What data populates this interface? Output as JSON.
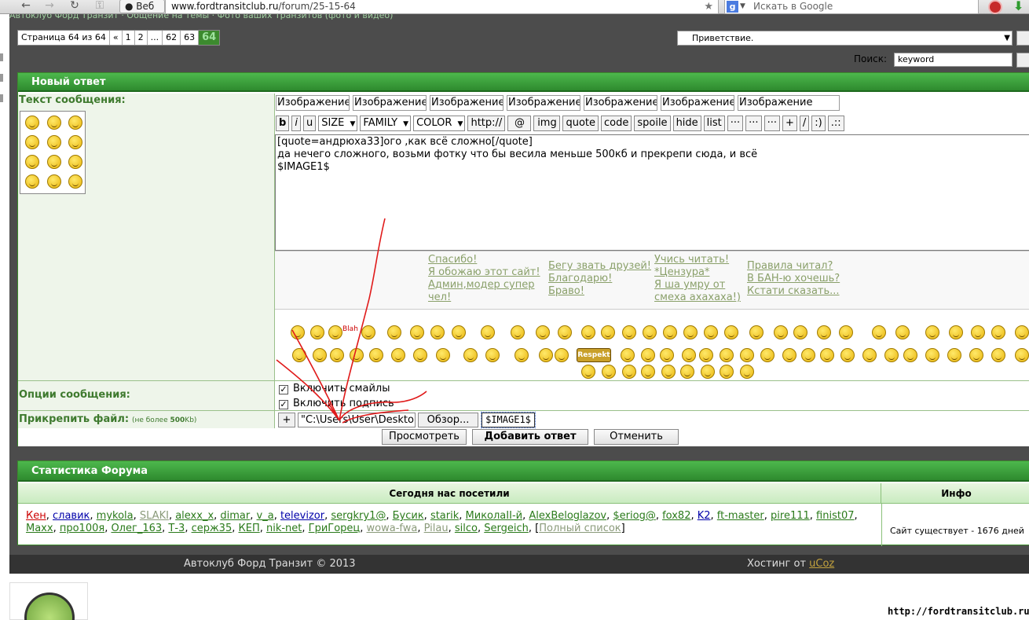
{
  "browser": {
    "web_label": "Веб",
    "url_domain": "www.fordtransitclub.ru",
    "url_path": "/forum/25-15-64",
    "search_placeholder": "Искать в Google"
  },
  "topbar": {
    "breadcrumb": "Автоклуб Форд Транзит · Общение на темы · Фото ваших Транзитов (фото и видео)",
    "pager": [
      "Страница 64 из 64",
      "«",
      "1",
      "2",
      "...",
      "62",
      "63",
      "64"
    ],
    "greeting": "Приветствие.",
    "search_label": "Поиск:",
    "search_value": "keyword"
  },
  "reply": {
    "title": "Новый ответ",
    "message_label": "Текст сообщения:",
    "image_buttons": [
      "Изображение",
      "Изображение",
      "Изображение",
      "Изображение",
      "Изображение",
      "Изображение",
      "Изображение"
    ],
    "bb_buttons": [
      "b",
      "i",
      "u",
      "SIZE",
      "FAMILY",
      "COLOR",
      "http://",
      "@",
      "img",
      "quote",
      "code",
      "spoile",
      "hide",
      "list",
      "···",
      "···",
      "···",
      "+",
      "/",
      ":)",
      ".::"
    ],
    "text_lines": [
      "[quote=андрюха33]ого ,как всё сложно[/quote]",
      "да нечего сложного, возьми фотку что бы весила меньше 500кб и прекрепи сюда, и всё",
      "$IMAGE1$"
    ],
    "quick_col1": [
      "Спасибо!",
      "Я обожаю этот сайт!",
      "Админ,модер супер",
      "чел!"
    ],
    "quick_col2": [
      "Бегу звать друзей!",
      "Благодарю!",
      "Браво!"
    ],
    "quick_col3": [
      "Учись читать!",
      "*Цензура*",
      "Я ша умру от",
      "смеха ахахаха!)"
    ],
    "quick_col4": [
      "Правила читал?",
      "В БАН-ю хочешь?",
      "Кстати сказать..."
    ],
    "options_label": "Опции сообщения:",
    "opt_smiles": "Включить смайлы",
    "opt_signature": "Включить подпись",
    "attach_label": "Прикрепить файл:",
    "attach_note_pre": "(не более ",
    "attach_note_b": "500",
    "attach_note_post": "Kb)",
    "plus": "+",
    "file_value": "\"C:\\Users\\User\\Deskto",
    "browse": "Обзор...",
    "image_tag": "$IMAGE1$",
    "btn_preview": "Просмотреть",
    "btn_submit": "Добавить ответ",
    "btn_cancel": "Отменить",
    "emoticon_blah": "Blah",
    "emoticon_respekt": "Respekt"
  },
  "stats": {
    "title": "Статистика Форума",
    "col_visitors": "Сегодня нас посетили",
    "col_info": "Инфо",
    "visitors": [
      {
        "name": "Кен",
        "color": "#cc0000"
      },
      {
        "name": "славик",
        "color": "#0000aa"
      },
      {
        "name": "mykola",
        "color": "#2a7a1a"
      },
      {
        "name": "SLAKI",
        "color": "#8a9a7a"
      },
      {
        "name": "alexx_x",
        "color": "#2a7a1a"
      },
      {
        "name": "dimar",
        "color": "#2a7a1a"
      },
      {
        "name": "v_a",
        "color": "#2a7a1a"
      },
      {
        "name": "televizor",
        "color": "#0000aa"
      },
      {
        "name": "sergkry1@",
        "color": "#2a7a1a"
      },
      {
        "name": "Бусик",
        "color": "#2a7a1a"
      },
      {
        "name": "starik",
        "color": "#2a7a1a"
      },
      {
        "name": "МиколаII-й",
        "color": "#2a7a1a"
      },
      {
        "name": "AlexBeloglazov",
        "color": "#2a7a1a"
      },
      {
        "name": "$eriog@",
        "color": "#2a7a1a"
      },
      {
        "name": "fox82",
        "color": "#2a7a1a"
      },
      {
        "name": "K2",
        "color": "#0000aa"
      },
      {
        "name": "ft-master",
        "color": "#2a7a1a"
      },
      {
        "name": "pire111",
        "color": "#2a7a1a"
      },
      {
        "name": "finist07",
        "color": "#2a7a1a"
      },
      {
        "name": "Maxx",
        "color": "#2a7a1a"
      },
      {
        "name": "про100я",
        "color": "#2a7a1a"
      },
      {
        "name": "Олег_163",
        "color": "#2a7a1a"
      },
      {
        "name": "Т-3",
        "color": "#2a7a1a"
      },
      {
        "name": "серж35",
        "color": "#2a7a1a"
      },
      {
        "name": "КЕП",
        "color": "#2a7a1a"
      },
      {
        "name": "nik-net",
        "color": "#2a7a1a"
      },
      {
        "name": "ГриГорец",
        "color": "#2a7a1a"
      },
      {
        "name": "wowa-fwa",
        "color": "#8a9a7a"
      },
      {
        "name": "Pilau",
        "color": "#8a9a7a"
      },
      {
        "name": "silco",
        "color": "#2a7a1a"
      },
      {
        "name": "Sergeich",
        "color": "#2a7a1a"
      }
    ],
    "full_list": "Полный список",
    "since": "Сайт существует - 1676 дней"
  },
  "footer": {
    "copyright": "Автоклуб Форд Транзит © 2013",
    "hosting": "Хостинг от ",
    "hosting_link": "uCoz",
    "watermark": "http://fordtransitclub.ru"
  }
}
